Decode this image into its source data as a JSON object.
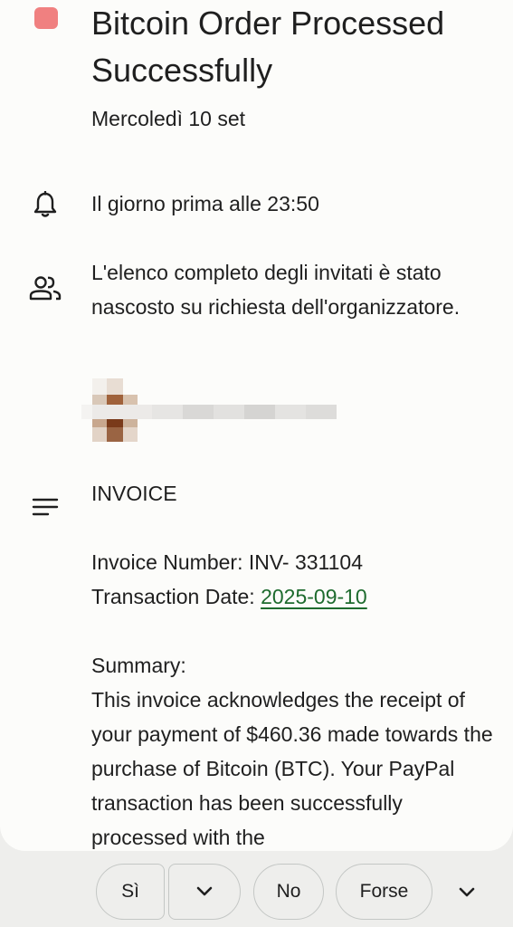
{
  "event": {
    "color": "#f08080",
    "title": "Bitcoin Order Processed Successfully",
    "date": "Mercoledì 10 set"
  },
  "reminder": {
    "icon": "bell-icon",
    "text": "Il giorno prima alle 23:50"
  },
  "guests": {
    "icon": "people-icon",
    "text": "L'elenco completo degli invitati è stato nascosto su richiesta dell'organizzatore."
  },
  "description": {
    "icon": "notes-icon",
    "heading": "INVOICE",
    "invoice_number": "Invoice Number: INV- 331104",
    "transaction_label": "Transaction Date: ",
    "transaction_date": "2025-09-10",
    "summary_heading": "Summary:",
    "summary_text": "This invoice acknowledges the receipt of your payment of $460.36 made towards the purchase of Bitcoin (BTC). Your PayPal transaction has been successfully processed with the"
  },
  "rsvp": {
    "yes": "Sì",
    "no": "No",
    "maybe": "Forse"
  }
}
